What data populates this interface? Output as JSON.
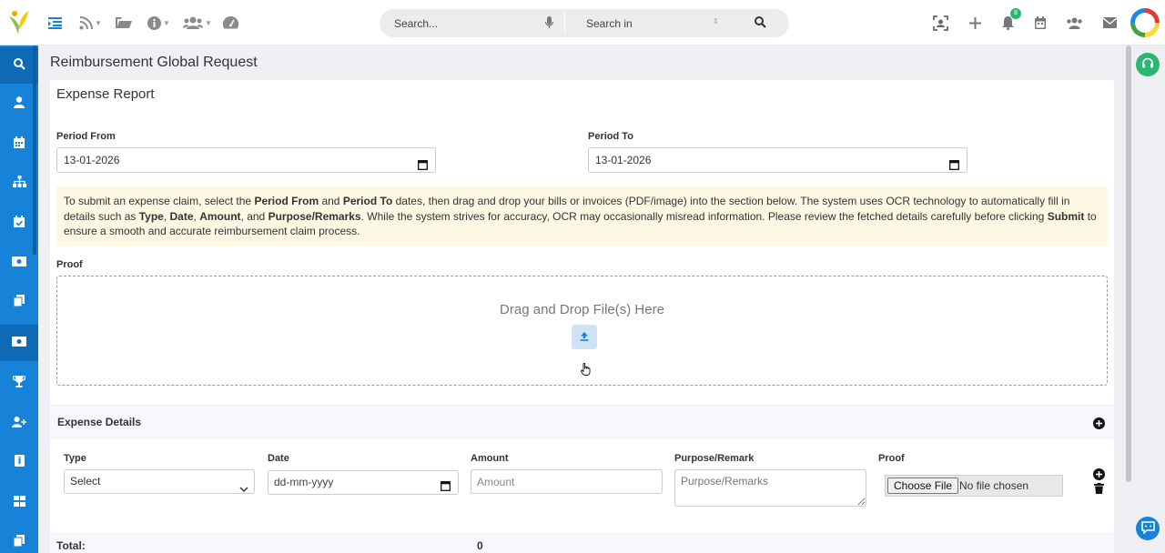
{
  "header": {
    "search_placeholder": "Search...",
    "search_in_label": "Search in",
    "notification_count": "8"
  },
  "page": {
    "title": "Reimbursement Global Request",
    "card_title": "Expense Report",
    "period_from_label": "Period From",
    "period_from_value": "13-01-2026",
    "period_to_label": "Period To",
    "period_to_value": "13-01-2026",
    "info": {
      "t1": "To submit an expense claim, select the ",
      "b1": "Period From",
      "t2": " and ",
      "b2": "Period To",
      "t3": " dates, then drag and drop your bills or invoices (PDF/image) into the section below. The system uses OCR technology to automatically fill in details such as ",
      "b3": "Type",
      "t4": ", ",
      "b4": "Date",
      "t5": ", ",
      "b5": "Amount",
      "t6": ", and ",
      "b6": "Purpose/Remarks",
      "t7": ". While the system strives for accuracy, OCR may occasionally misread information. Please review the fetched details carefully before clicking ",
      "b7": "Submit",
      "t8": " to ensure a smooth and accurate reimbursement claim process."
    },
    "proof_label": "Proof",
    "dropzone_text": "Drag and Drop File(s) Here",
    "expense_details": {
      "title": "Expense Details",
      "type_label": "Type",
      "type_selected": "Select",
      "date_label": "Date",
      "date_placeholder": "dd-mm-yyyy",
      "amount_label": "Amount",
      "amount_placeholder": "Amount",
      "purpose_label": "Purpose/Remark",
      "purpose_placeholder": "Purpose/Remarks",
      "proof_label": "Proof",
      "choose_file_label": "Choose File",
      "no_file_text": "No file chosen"
    },
    "total_label": "Total:",
    "total_value": "0"
  },
  "colors": {
    "sidebar": "#1683d8",
    "info_bg": "#fdf8e4",
    "accent_green": "#2bb673"
  }
}
